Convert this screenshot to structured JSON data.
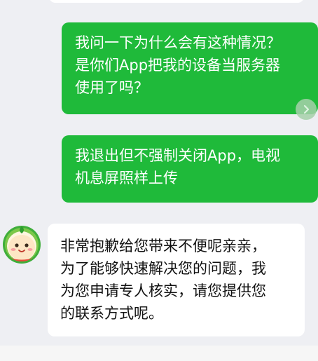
{
  "messages": [
    {
      "sender": "user",
      "text": "我问一下为什么会有这种情况？\n是你们App把我的设备当服务器\n使用了吗？"
    },
    {
      "sender": "user",
      "text": "我退出但不强制关闭App，电视\n机息屏照样上传"
    },
    {
      "sender": "agent",
      "text": "非常抱歉给您带来不便呢亲亲，\n为了能够快速解决您的问题，我\n为您申请专人核实，请您提供您\n的联系方式呢。"
    }
  ],
  "colors": {
    "outgoing_bubble": "#1fba3a",
    "incoming_bubble": "#ffffff",
    "background": "#eeeff3"
  },
  "icons": {
    "scroll_button": "chevron-right-icon",
    "agent_avatar": "watermelon-mascot-avatar"
  }
}
